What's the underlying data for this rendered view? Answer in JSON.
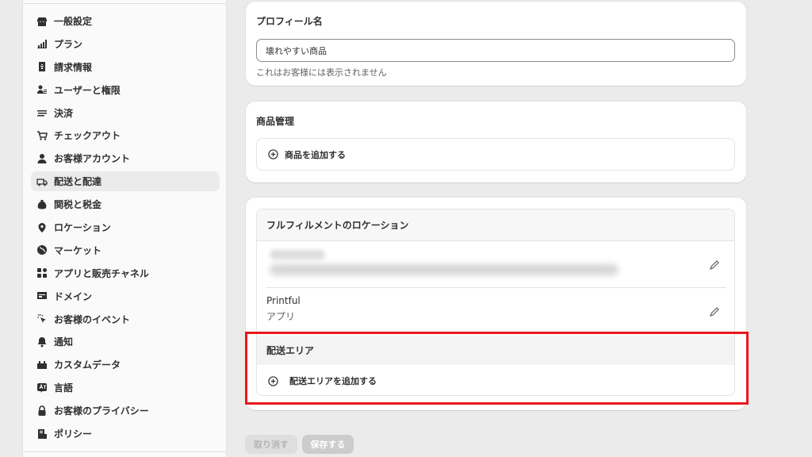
{
  "sidebar": {
    "items": [
      {
        "label": "一般設定",
        "icon": "store-icon",
        "active": false
      },
      {
        "label": "プラン",
        "icon": "plan-chart-icon",
        "active": false
      },
      {
        "label": "請求情報",
        "icon": "billing-icon",
        "active": false
      },
      {
        "label": "ユーザーと権限",
        "icon": "users-icon",
        "active": false
      },
      {
        "label": "決済",
        "icon": "payment-icon",
        "active": false
      },
      {
        "label": "チェックアウト",
        "icon": "cart-icon",
        "active": false
      },
      {
        "label": "お客様アカウント",
        "icon": "person-icon",
        "active": false
      },
      {
        "label": "配送と配達",
        "icon": "truck-icon",
        "active": true
      },
      {
        "label": "関税と税金",
        "icon": "money-bag-icon",
        "active": false
      },
      {
        "label": "ロケーション",
        "icon": "location-pin-icon",
        "active": false
      },
      {
        "label": "マーケット",
        "icon": "globe-icon",
        "active": false
      },
      {
        "label": "アプリと販売チャネル",
        "icon": "apps-icon",
        "active": false
      },
      {
        "label": "ドメイン",
        "icon": "domain-icon",
        "active": false
      },
      {
        "label": "お客様のイベント",
        "icon": "cursor-click-icon",
        "active": false
      },
      {
        "label": "通知",
        "icon": "bell-icon",
        "active": false
      },
      {
        "label": "カスタムデータ",
        "icon": "custom-data-icon",
        "active": false
      },
      {
        "label": "言語",
        "icon": "language-icon",
        "active": false
      },
      {
        "label": "お客様のプライバシー",
        "icon": "lock-icon",
        "active": false
      },
      {
        "label": "ポリシー",
        "icon": "policy-icon",
        "active": false
      }
    ]
  },
  "profile": {
    "title": "プロフィール名",
    "value": "壊れやすい商品",
    "help": "これはお客様には表示されません"
  },
  "products": {
    "title": "商品管理",
    "add_label": "商品を追加する"
  },
  "fulfillment": {
    "title": "フルフィルメントのロケーション",
    "locations": [
      {
        "name": "Printful",
        "sub": "アプリ"
      }
    ],
    "area_title": "配送エリア",
    "area_add_label": "配送エリアを追加する"
  },
  "actions": {
    "cancel_label": "取り消す",
    "save_label": "保存する"
  },
  "colors": {
    "highlight": "#e8181d",
    "background": "#ebebeb"
  }
}
